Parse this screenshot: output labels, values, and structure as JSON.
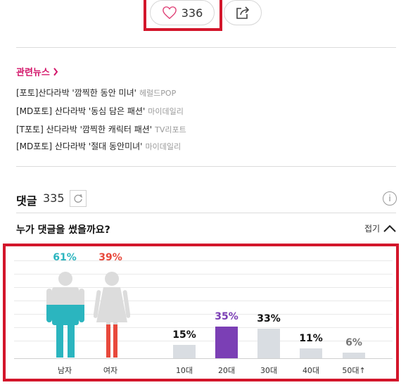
{
  "actions": {
    "like_count": "336",
    "icons": {
      "like": "heart-outline-icon",
      "share": "share-icon"
    }
  },
  "related_news": {
    "title": "관련뉴스",
    "items": [
      {
        "text": "[포토]산다라박 '깜찍한 동안 미녀'",
        "source": "헤럴드POP"
      },
      {
        "text": "[MD포토] 산다라박 '동심 담은 패션'",
        "source": "마이데일리"
      },
      {
        "text": "[T포토] 산다라박 '깜찍한 캐릭터 패션'",
        "source": "TV리포트"
      },
      {
        "text": "[MD포토] 산다라박 '절대 동안미녀'",
        "source": "마이데일리"
      }
    ]
  },
  "comments": {
    "label": "댓글",
    "count": "335",
    "who_title": "누가 댓글을 썼을까요?",
    "collapse_label": "접기"
  },
  "gender": {
    "male": {
      "label": "남자",
      "pct_text": "61%",
      "value": 61,
      "color": "#2bb5bf"
    },
    "female": {
      "label": "여자",
      "pct_text": "39%",
      "value": 39,
      "color": "#e8493c"
    }
  },
  "chart_data": {
    "type": "bar",
    "categories": [
      "10대",
      "20대",
      "30대",
      "40대",
      "50대↑"
    ],
    "values": [
      15,
      35,
      33,
      11,
      6
    ],
    "labels": [
      "15%",
      "35%",
      "33%",
      "11%",
      "6%"
    ],
    "highlight_index": 1,
    "colors": {
      "normal": "#d9dde2",
      "highlight": "#7b3fb5",
      "label_normal": "#111111",
      "label_highlight": "#7b3fb5",
      "label_small": "#777777"
    }
  }
}
